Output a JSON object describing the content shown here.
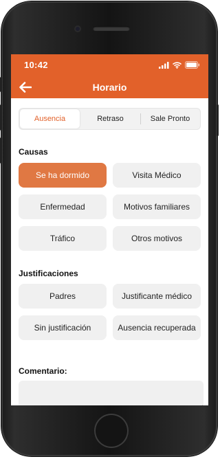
{
  "status_bar": {
    "time": "10:42"
  },
  "nav": {
    "title": "Horario"
  },
  "tabs": [
    {
      "label": "Ausencia",
      "active": true
    },
    {
      "label": "Retraso",
      "active": false
    },
    {
      "label": "Sale Pronto",
      "active": false
    }
  ],
  "causes": {
    "title": "Causas",
    "options": [
      {
        "label": "Se ha dormido",
        "selected": true
      },
      {
        "label": "Visita Médico",
        "selected": false
      },
      {
        "label": "Enfermedad",
        "selected": false
      },
      {
        "label": "Motivos familiares",
        "selected": false
      },
      {
        "label": "Tráfico",
        "selected": false
      },
      {
        "label": "Otros motivos",
        "selected": false
      }
    ]
  },
  "justifications": {
    "title": "Justificaciones",
    "options": [
      {
        "label": "Padres"
      },
      {
        "label": "Justificante médico"
      },
      {
        "label": "Sin justificación"
      },
      {
        "label": "Ausencia recuperada"
      }
    ]
  },
  "comment": {
    "label": "Comentario:",
    "value": ""
  },
  "colors": {
    "accent": "#e2612a",
    "selected_option": "#e07843",
    "option_bg": "#f0f0f0"
  },
  "icons": [
    "back-arrow-icon",
    "signal-icon",
    "wifi-icon",
    "battery-icon"
  ]
}
